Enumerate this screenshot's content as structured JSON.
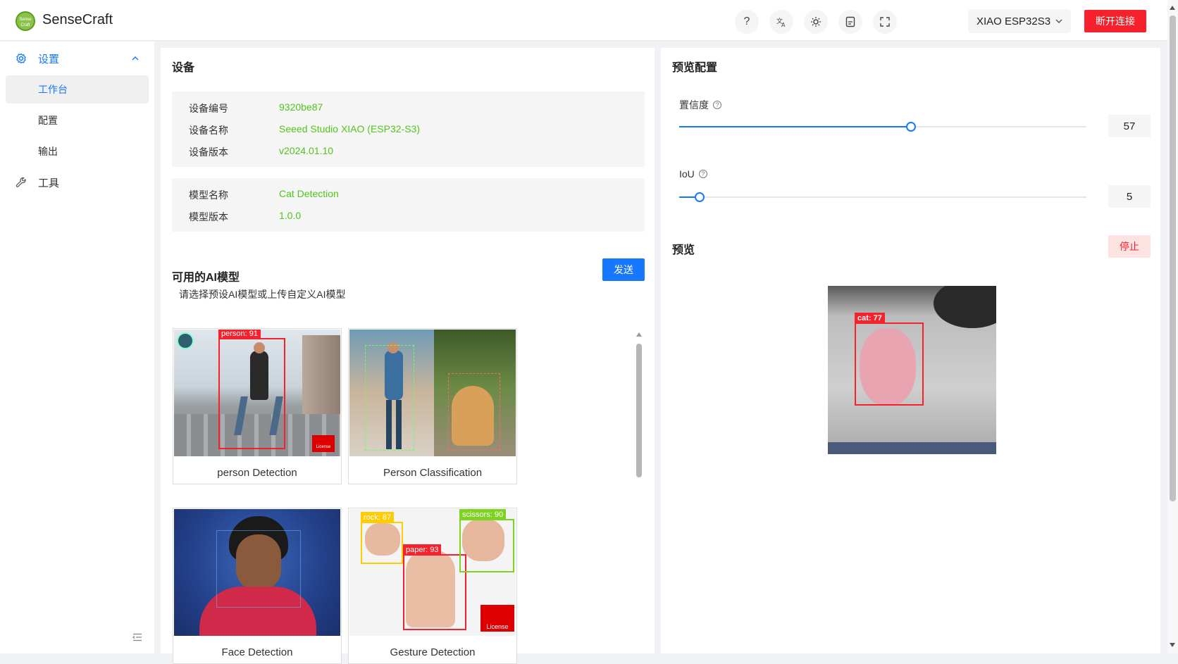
{
  "header": {
    "logo_text": "Sense Craft",
    "brand": "SenseCraft",
    "device": "XIAO ESP32S3",
    "disconnect_label": "断开连接",
    "icons": [
      "help-icon",
      "translate-icon",
      "theme-icon",
      "document-icon",
      "fullscreen-icon"
    ]
  },
  "sidebar": {
    "settings_label": "设置",
    "items": [
      {
        "label": "工作台",
        "active": true
      },
      {
        "label": "配置",
        "active": false
      },
      {
        "label": "输出",
        "active": false
      }
    ],
    "tools_label": "工具"
  },
  "device": {
    "title": "设备",
    "rows": [
      {
        "key": "设备编号",
        "value": "9320be87"
      },
      {
        "key": "设备名称",
        "value": "Seeed Studio XIAO (ESP32-S3)"
      },
      {
        "key": "设备版本",
        "value": "v2024.01.10"
      }
    ],
    "model_rows": [
      {
        "key": "模型名称",
        "value": "Cat Detection"
      },
      {
        "key": "模型版本",
        "value": "1.0.0"
      }
    ]
  },
  "models": {
    "title": "可用的AI模型",
    "send_label": "发送",
    "subtitle": "请选择预设AI模型或上传自定义AI模型",
    "cards": [
      {
        "name": "person Detection",
        "tags": [
          "person: 91"
        ]
      },
      {
        "name": "Person Classification",
        "tags": []
      },
      {
        "name": "Face Detection",
        "tags": []
      },
      {
        "name": "Gesture Detection",
        "tags": [
          "rock: 87",
          "paper: 93",
          "scissors: 90"
        ]
      }
    ],
    "license_label": "License"
  },
  "preview_config": {
    "title": "预览配置",
    "confidence_label": "置信度",
    "confidence_value": "57",
    "confidence_fraction": 0.57,
    "iou_label": "IoU",
    "iou_value": "5",
    "iou_fraction": 0.05,
    "preview_title": "预览",
    "stop_label": "停止",
    "detection_tag": "cat: 77"
  },
  "colors": {
    "primary": "#1677ff",
    "danger": "#f5222d",
    "success": "#52c41a"
  }
}
